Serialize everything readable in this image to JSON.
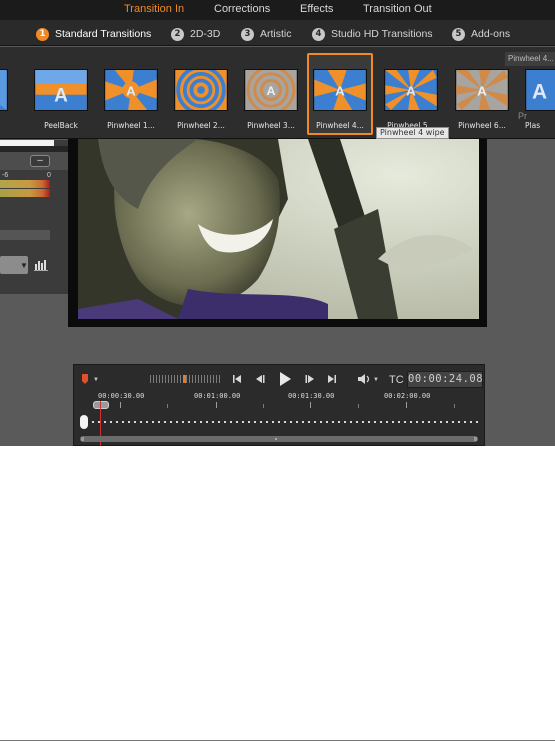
{
  "top_tabs": [
    {
      "label": "Transition In",
      "active": true
    },
    {
      "label": "Corrections",
      "active": false
    },
    {
      "label": "Effects",
      "active": false
    },
    {
      "label": "Transition Out",
      "active": false
    }
  ],
  "categories": [
    {
      "num": "1",
      "label": "Standard Transitions",
      "active": true
    },
    {
      "num": "2",
      "label": "2D-3D",
      "active": false
    },
    {
      "num": "3",
      "label": "Artistic",
      "active": false
    },
    {
      "num": "4",
      "label": "Studio HD Transitions",
      "active": false
    },
    {
      "num": "5",
      "label": "Add-ons",
      "active": false
    }
  ],
  "transitions": [
    {
      "label": "PeelBack",
      "style": "peelback",
      "selected": false
    },
    {
      "label": "Pinwheel 1...",
      "style": "pinwheel",
      "selected": false
    },
    {
      "label": "Pinwheel 2...",
      "style": "spiral",
      "selected": false
    },
    {
      "label": "Pinwheel 3...",
      "style": "spiral-gray",
      "selected": false
    },
    {
      "label": "Pinwheel 4...",
      "style": "pinwheel-blades",
      "selected": true
    },
    {
      "label": "Pinwheel 5...",
      "style": "rays",
      "selected": false
    },
    {
      "label": "Pinwheel 6...",
      "style": "rays-gray",
      "selected": false
    },
    {
      "label": "Plas",
      "style": "plain",
      "selected": false
    }
  ],
  "tooltip": "Pinwheel 4 wipe",
  "right_panel": {
    "field": "Pinwheel 4...",
    "text": "Pr"
  },
  "level_meter": {
    "mark_left": "-6",
    "mark_right": "0"
  },
  "transport": {
    "tc_label": "TC",
    "timecode": "00:00:24.08",
    "ruler_labels": [
      "00:00:30.00",
      "00:01:00.00",
      "00:01:30.00",
      "00:02:00.00"
    ]
  },
  "colors": {
    "accent": "#f08a24",
    "playhead": "#d03030",
    "thumb_blue": "#3c7fd0",
    "thumb_orange": "#f0902a"
  }
}
